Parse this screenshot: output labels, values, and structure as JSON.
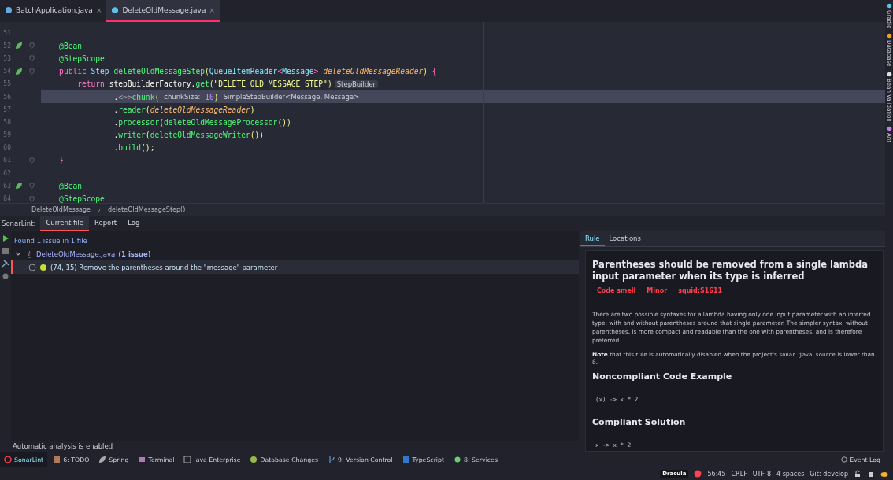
{
  "editor_tabs": [
    {
      "label": "BatchApplication.java",
      "selected": false,
      "close": "×"
    },
    {
      "label": "DeleteOldMessage.java",
      "selected": true,
      "close": "×"
    }
  ],
  "code_lines": [
    {
      "number": "51",
      "current": false,
      "bean_icon": false,
      "fold_marker": false
    },
    {
      "number": "52",
      "current": false,
      "bean_icon": true,
      "fold_marker": true,
      "tokens": [
        {
          "kind": "annotation",
          "text": "    @Bean"
        }
      ]
    },
    {
      "number": "53",
      "current": false,
      "bean_icon": false,
      "fold_marker": true,
      "tokens": [
        {
          "kind": "annotation",
          "text": "    @StepScope"
        }
      ]
    },
    {
      "number": "54",
      "current": false,
      "bean_icon": true,
      "fold_marker": true,
      "tokens": [
        {
          "kind": "keyword",
          "text": "    public "
        },
        {
          "kind": "type",
          "text": "Step "
        },
        {
          "kind": "function",
          "text": "deleteOldMessageStep"
        },
        {
          "kind": "paren",
          "text": "("
        },
        {
          "kind": "type",
          "text": "QueueItemReader"
        },
        {
          "kind": "keyword",
          "text": "<"
        },
        {
          "kind": "type",
          "text": "Message"
        },
        {
          "kind": "keyword",
          "text": "> "
        },
        {
          "kind": "param",
          "text": "deleteOldMessageReader"
        },
        {
          "kind": "paren",
          "text": ") "
        },
        {
          "kind": "keyword",
          "text": "{"
        }
      ]
    },
    {
      "number": "55",
      "current": false,
      "bean_icon": false,
      "fold_marker": false,
      "tokens": [
        {
          "kind": "keyword",
          "text": "        return "
        },
        {
          "kind": "plain",
          "text": "stepBuilderFactory."
        },
        {
          "kind": "function",
          "text": "get"
        },
        {
          "kind": "paren",
          "text": "("
        },
        {
          "kind": "string",
          "text": "\"DELETE OLD MESSAGE STEP\""
        },
        {
          "kind": "paren",
          "text": ")"
        },
        {
          "kind": "hint",
          "text": "StepBuilder"
        }
      ]
    },
    {
      "number": "56",
      "current": true,
      "bean_icon": false,
      "fold_marker": false,
      "tokens": [
        {
          "kind": "plain",
          "text": "                ."
        },
        {
          "kind": "dim",
          "text": "<~>"
        },
        {
          "kind": "function",
          "text": "chunk"
        },
        {
          "kind": "paren",
          "text": "("
        },
        {
          "kind": "hint",
          "text": "chunkSize:"
        },
        {
          "kind": "number",
          "text": "10"
        },
        {
          "kind": "paren",
          "text": ")"
        },
        {
          "kind": "hint",
          "text": "SimpleStepBuilder<Message, Message>"
        }
      ]
    },
    {
      "number": "57",
      "current": false,
      "bean_icon": false,
      "fold_marker": false,
      "tokens": [
        {
          "kind": "plain",
          "text": "                ."
        },
        {
          "kind": "function",
          "text": "reader"
        },
        {
          "kind": "paren",
          "text": "("
        },
        {
          "kind": "param",
          "text": "deleteOldMessageReader"
        },
        {
          "kind": "paren",
          "text": ")"
        }
      ]
    },
    {
      "number": "58",
      "current": false,
      "bean_icon": false,
      "fold_marker": false,
      "tokens": [
        {
          "kind": "plain",
          "text": "                ."
        },
        {
          "kind": "function",
          "text": "processor"
        },
        {
          "kind": "paren",
          "text": "("
        },
        {
          "kind": "function",
          "text": "deleteOldMessageProcessor"
        },
        {
          "kind": "paren",
          "text": "())"
        }
      ]
    },
    {
      "number": "59",
      "current": false,
      "bean_icon": false,
      "fold_marker": false,
      "tokens": [
        {
          "kind": "plain",
          "text": "                ."
        },
        {
          "kind": "function",
          "text": "writer"
        },
        {
          "kind": "paren",
          "text": "("
        },
        {
          "kind": "function",
          "text": "deleteOldMessageWriter"
        },
        {
          "kind": "paren",
          "text": "())"
        }
      ]
    },
    {
      "number": "60",
      "current": false,
      "bean_icon": false,
      "fold_marker": false,
      "tokens": [
        {
          "kind": "plain",
          "text": "                ."
        },
        {
          "kind": "function",
          "text": "build"
        },
        {
          "kind": "paren",
          "text": "()"
        },
        {
          "kind": "plain",
          "text": ";"
        }
      ]
    },
    {
      "number": "61",
      "current": false,
      "bean_icon": false,
      "fold_marker": true,
      "tokens": [
        {
          "kind": "keyword",
          "text": "    }"
        }
      ]
    },
    {
      "number": "62",
      "current": false,
      "bean_icon": false,
      "fold_marker": false
    },
    {
      "number": "63",
      "current": false,
      "bean_icon": true,
      "fold_marker": true,
      "tokens": [
        {
          "kind": "annotation",
          "text": "    @Bean"
        }
      ]
    },
    {
      "number": "64",
      "current": false,
      "bean_icon": false,
      "fold_marker": true,
      "tokens": [
        {
          "kind": "annotation",
          "text": "    @StepScope"
        }
      ]
    }
  ],
  "breadcrumbs": [
    "DeleteOldMessage",
    "deleteOldMessageStep()"
  ],
  "right_strip": [
    {
      "label": "Gradle"
    },
    {
      "label": "Database"
    },
    {
      "label": "Bean Validation"
    },
    {
      "label": "Ant"
    }
  ],
  "sonarlint": {
    "title": "SonarLint:",
    "tabs": [
      {
        "label": "Current file",
        "selected": true
      },
      {
        "label": "Report",
        "selected": false
      },
      {
        "label": "Log",
        "selected": false
      }
    ],
    "summary": "Found 1 issue in 1 file",
    "file": {
      "name": "DeleteOldMessage.java",
      "count": "(1 issue)",
      "expanded": true,
      "issues": [
        {
          "text": "(74, 15) Remove the parentheses around the \"message\" parameter",
          "selected": true
        }
      ]
    },
    "footer": "Automatic analysis is enabled"
  },
  "rule_panel": {
    "tabs": [
      {
        "label": "Rule",
        "selected": true
      },
      {
        "label": "Locations",
        "selected": false
      }
    ],
    "title": "Parentheses should be removed from a single lambda input parameter when its type is inferred",
    "tags": [
      "Code smell",
      "Minor",
      "squid:S1611"
    ],
    "description": "There are two possible syntaxes for a lambda having only one input parameter with an inferred type: with and without parentheses around that single parameter. The simpler syntax, without parentheses, is more compact and readable than the one with parentheses, and is therefore preferred.",
    "note": {
      "before": "**Note** that this rule is automatically disabled when the project's ",
      "code": "sonar.java.source",
      "after": " is lower than 8."
    },
    "sections": [
      {
        "heading": "Noncompliant Code Example",
        "code": "(x) -> x * 2"
      },
      {
        "heading": "Compliant Solution",
        "code": "x -> x * 2"
      }
    ]
  },
  "tool_buttons": [
    {
      "label": "SonarLint",
      "selected": true,
      "mnemonic": false
    },
    {
      "label": "6: TODO",
      "selected": false,
      "mnemonic": true
    },
    {
      "label": "Spring",
      "selected": false,
      "mnemonic": false
    },
    {
      "label": "Terminal",
      "selected": false,
      "mnemonic": false
    },
    {
      "label": "Java Enterprise",
      "selected": false,
      "mnemonic": false
    },
    {
      "label": "Database Changes",
      "selected": false,
      "mnemonic": false
    },
    {
      "label": "9: Version Control",
      "selected": false,
      "mnemonic": true
    },
    {
      "label": "TypeScript",
      "selected": false,
      "mnemonic": false
    },
    {
      "label": "8: Services",
      "selected": false,
      "mnemonic": true
    }
  ],
  "event_log": "Event Log",
  "status_bar": {
    "theme": "Dracula",
    "position": "56:45",
    "line_separator": "CRLF",
    "encoding": "UTF-8",
    "indent": "4 spaces",
    "git": "Git: develop"
  }
}
